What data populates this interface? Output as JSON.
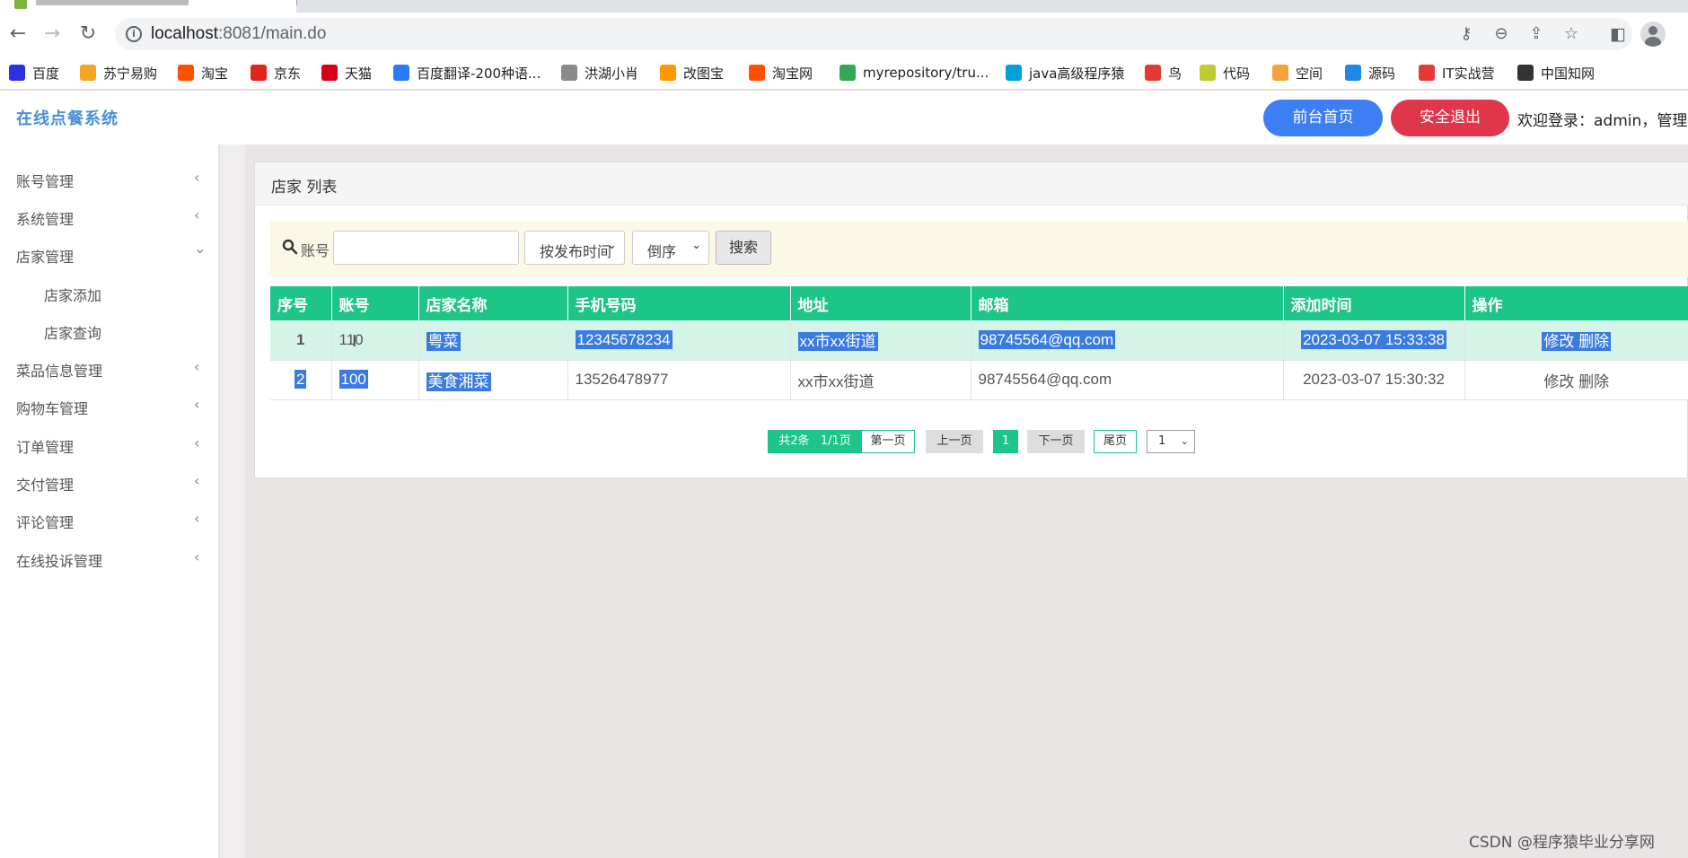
{
  "browser": {
    "url_host": "localhost",
    "url_rest": ":8081/main.do"
  },
  "bookmarks": [
    {
      "label": "百度",
      "icon": "baidu-paw-icon",
      "color": "#2932e1"
    },
    {
      "label": "苏宁易购",
      "icon": "suning-lion-icon",
      "color": "#f5a623"
    },
    {
      "label": "淘宝",
      "icon": "taobao-icon",
      "color": "#ff5000"
    },
    {
      "label": "京东",
      "icon": "jd-icon",
      "color": "#e1251b"
    },
    {
      "label": "天猫",
      "icon": "tmall-icon",
      "color": "#d5001c"
    },
    {
      "label": "百度翻译-200种语...",
      "icon": "translate-icon",
      "color": "#2b7bf7"
    },
    {
      "label": "洪湖小肖",
      "icon": "eagle-icon",
      "color": "#8a8a8a"
    },
    {
      "label": "改图宝",
      "icon": "gaitubao-icon",
      "color": "#ff9800"
    },
    {
      "label": "淘宝网",
      "icon": "taobao-icon",
      "color": "#ff5000"
    },
    {
      "label": "myrepository/tru...",
      "icon": "chrome-icon",
      "color": "#34a853"
    },
    {
      "label": "java高级程序猿",
      "icon": "bilibili-icon",
      "color": "#00a1d6"
    },
    {
      "label": "鸟",
      "icon": "bird-icon",
      "color": "#e53935"
    },
    {
      "label": "代码",
      "icon": "code-icon",
      "color": "#c0ca33"
    },
    {
      "label": "空间",
      "icon": "qzone-icon",
      "color": "#f2a33a"
    },
    {
      "label": "源码",
      "icon": "fish-icon",
      "color": "#1e88e5"
    },
    {
      "label": "IT实战营",
      "icon": "it-icon",
      "color": "#e53935"
    },
    {
      "label": "中国知网",
      "icon": "cnki-icon",
      "color": "#333333"
    }
  ],
  "header": {
    "brand": "在线点餐系统",
    "home_button": "前台首页",
    "logout_button": "安全退出",
    "welcome": "欢迎登录：admin，管理员"
  },
  "sidebar": {
    "items": [
      {
        "label": "账号管理",
        "chevron": "‹"
      },
      {
        "label": "系统管理",
        "chevron": "‹"
      },
      {
        "label": "店家管理",
        "chevron": "⌄"
      },
      {
        "label": "店家添加"
      },
      {
        "label": "店家查询"
      },
      {
        "label": "菜品信息管理",
        "chevron": "‹"
      },
      {
        "label": "购物车管理",
        "chevron": "‹"
      },
      {
        "label": "订单管理",
        "chevron": "‹"
      },
      {
        "label": "交付管理",
        "chevron": "‹"
      },
      {
        "label": "评论管理",
        "chevron": "‹"
      },
      {
        "label": "在线投诉管理",
        "chevron": "‹"
      }
    ]
  },
  "panel": {
    "title": "店家 列表"
  },
  "search": {
    "label": "账号",
    "value": "",
    "sort_field": "按发布时间",
    "sort_order": "倒序",
    "button": "搜索"
  },
  "table": {
    "headers": [
      "序号",
      "账号",
      "店家名称",
      "手机号码",
      "地址",
      "邮箱",
      "添加时间",
      "操作"
    ],
    "rows": [
      {
        "index": "1",
        "account": "110",
        "name": "粤菜",
        "phone": "12345678234",
        "address": "xx市xx街道",
        "email": "98745564@qq.com",
        "time": "2023-03-07 15:33:38",
        "edit": "修改",
        "delete": "删除"
      },
      {
        "index": "2",
        "account": "100",
        "name": "美食湘菜",
        "phone": "13526478977",
        "address": "xx市xx街道",
        "email": "98745564@qq.com",
        "time": "2023-03-07 15:30:32",
        "edit": "修改",
        "delete": "删除"
      }
    ]
  },
  "pager": {
    "total": "共2条",
    "pages": "1/1页",
    "first": "第一页",
    "prev": "上一页",
    "current": "1",
    "next": "下一页",
    "last": "尾页",
    "page_select": "1"
  },
  "watermark": "CSDN @程序猿毕业分享网",
  "colors": {
    "accent_green": "#1ec589",
    "home_blue": "#3d7ef5",
    "logout_red": "#e0354b",
    "selection_blue": "#3a7be0"
  }
}
